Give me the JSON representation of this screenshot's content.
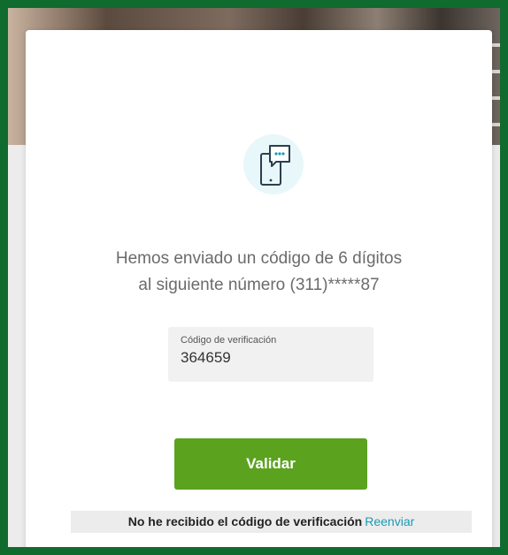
{
  "verification": {
    "message_line1": "Hemos enviado un código de 6 dígitos",
    "message_line2": "al siguiente número (311)*****87",
    "field_label": "Código de verificación",
    "field_value": "364659",
    "submit_label": "Validar",
    "not_received_text": "No he recibido el código de verificación",
    "resend_link": "Reenviar"
  },
  "icons": {
    "header_icon": "phone-chat-icon"
  },
  "colors": {
    "frame_border": "#0f6b2e",
    "button": "#5ba21f",
    "link": "#1a9bb5",
    "icon_circle": "#e8f7f9",
    "icon_accent": "#1a9bb5"
  }
}
